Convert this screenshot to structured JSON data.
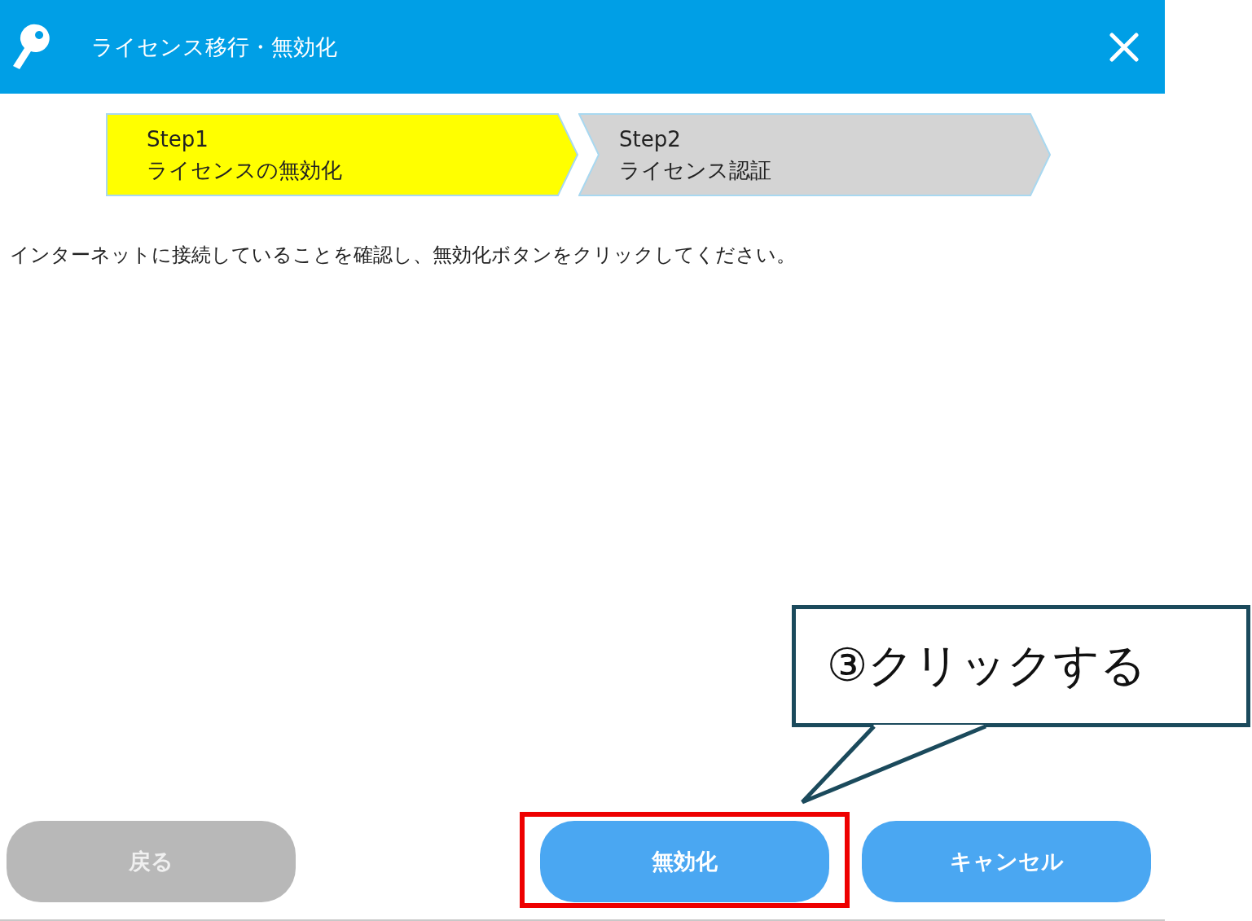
{
  "window": {
    "title": "ライセンス移行・無効化"
  },
  "steps": [
    {
      "label": "Step1",
      "caption": "ライセンスの無効化",
      "selected": true
    },
    {
      "label": "Step2",
      "caption": "ライセンス認証",
      "selected": false
    }
  ],
  "message": "インターネットに接続していることを確認し、無効化ボタンをクリックしてください。",
  "buttons": [
    {
      "label": "戻る",
      "disabled": true,
      "highlighted": false
    },
    {
      "label": "無効化",
      "disabled": false,
      "highlighted": true
    },
    {
      "label": "キャンセル",
      "disabled": false,
      "highlighted": false
    }
  ],
  "callout": {
    "text": "③クリックする"
  }
}
